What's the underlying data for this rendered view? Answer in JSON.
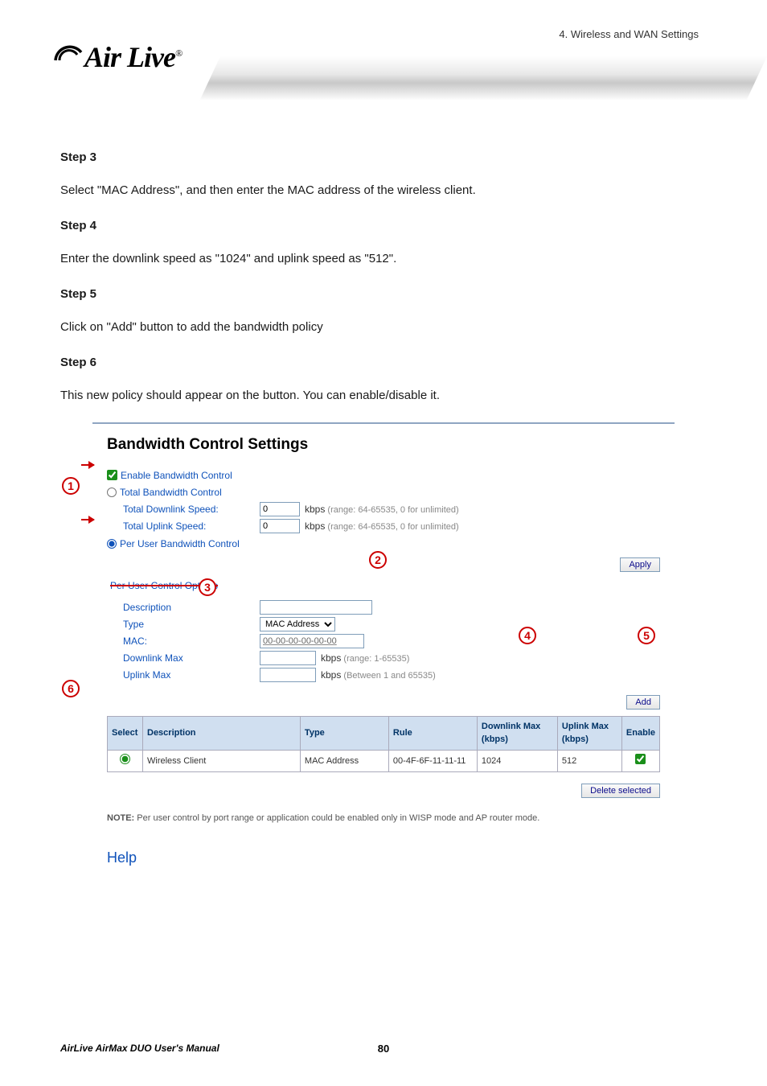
{
  "header": {
    "chapter": "4. Wireless and WAN Settings",
    "logo": "Air Live",
    "logo_sup": "®"
  },
  "steps": [
    {
      "heading": "Step 3",
      "text": "Select \"MAC Address\", and then enter the MAC address of the wireless client."
    },
    {
      "heading": "Step 4",
      "text": "Enter the downlink speed as \"1024\" and uplink speed as \"512\"."
    },
    {
      "heading": "Step 5",
      "text": "Click on \"Add\" button to add the bandwidth policy"
    },
    {
      "heading": "Step 6",
      "text": "This new policy should appear on the button. You can enable/disable it."
    }
  ],
  "panel": {
    "title": "Bandwidth Control Settings",
    "enable_label": "Enable Bandwidth Control",
    "total_label": "Total Bandwidth Control",
    "total_dl_label": "Total Downlink Speed:",
    "total_dl_value": "0",
    "total_ul_label": "Total Uplink Speed:",
    "total_ul_value": "0",
    "range_hint": "(range: 64-65535, 0 for unlimited)",
    "kbps_label": "kbps",
    "peruser_label": "Per User Bandwidth Control",
    "apply_btn": "Apply",
    "options_title": "Per User Control Options",
    "desc_label": "Description",
    "type_label": "Type",
    "type_value": "MAC Address",
    "mac_label": "MAC:",
    "mac_value": "00-00-00-00-00-00",
    "dl_max_label": "Downlink Max",
    "dl_hint": "(range: 1-65535)",
    "ul_max_label": "Uplink Max",
    "ul_hint": "(Between 1 and 65535)",
    "add_btn": "Add",
    "table": {
      "headers": [
        "Select",
        "Description",
        "Type",
        "Rule",
        "Downlink Max (kbps)",
        "Uplink Max (kbps)",
        "Enable"
      ],
      "row": {
        "description": "Wireless Client",
        "type": "MAC Address",
        "rule": "00-4F-6F-11-11-11",
        "downlink": "1024",
        "uplink": "512"
      }
    },
    "delete_btn": "Delete selected",
    "note_prefix": "NOTE:",
    "note_text": " Per user control by port range or application could be enabled only in WISP mode and AP router mode.",
    "help": "Help"
  },
  "annotations": [
    "1",
    "2",
    "3",
    "4",
    "5",
    "6"
  ],
  "footer": {
    "title": "AirLive AirMax DUO User's Manual",
    "page": "80"
  }
}
